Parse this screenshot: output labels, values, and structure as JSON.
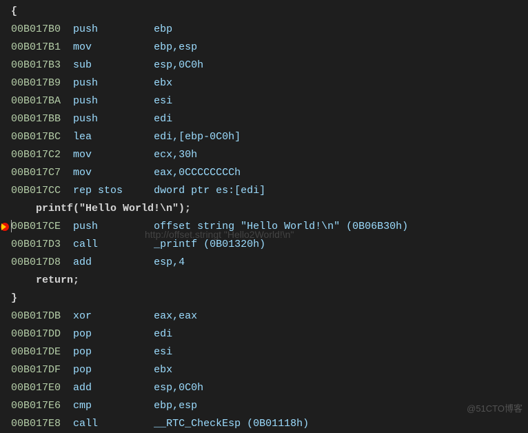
{
  "lines": [
    {
      "type": "brace",
      "text": "{"
    },
    {
      "type": "asm",
      "addr": "00B017B0",
      "mnemonic": "push",
      "operand": "ebp"
    },
    {
      "type": "asm",
      "addr": "00B017B1",
      "mnemonic": "mov",
      "operand": "ebp,esp"
    },
    {
      "type": "asm",
      "addr": "00B017B3",
      "mnemonic": "sub",
      "operand": "esp,0C0h"
    },
    {
      "type": "asm",
      "addr": "00B017B9",
      "mnemonic": "push",
      "operand": "ebx"
    },
    {
      "type": "asm",
      "addr": "00B017BA",
      "mnemonic": "push",
      "operand": "esi"
    },
    {
      "type": "asm",
      "addr": "00B017BB",
      "mnemonic": "push",
      "operand": "edi"
    },
    {
      "type": "asm",
      "addr": "00B017BC",
      "mnemonic": "lea",
      "operand": "edi,[ebp-0C0h]"
    },
    {
      "type": "asm",
      "addr": "00B017C2",
      "mnemonic": "mov",
      "operand": "ecx,30h"
    },
    {
      "type": "asm",
      "addr": "00B017C7",
      "mnemonic": "mov",
      "operand": "eax,0CCCCCCCCh"
    },
    {
      "type": "asm",
      "addr": "00B017CC",
      "mnemonic": "rep stos",
      "operand": "dword ptr es:[edi]"
    },
    {
      "type": "src",
      "text": "    printf(\"Hello World!\\n\");"
    },
    {
      "type": "asm",
      "addr": "00B017CE",
      "mnemonic": "push",
      "operand": "offset string \"Hello World!\\n\" (0B06B30h)",
      "breakpoint": true,
      "current": true
    },
    {
      "type": "asm",
      "addr": "00B017D3",
      "mnemonic": "call",
      "operand": "_printf (0B01320h)"
    },
    {
      "type": "asm",
      "addr": "00B017D8",
      "mnemonic": "add",
      "operand": "esp,4"
    },
    {
      "type": "src",
      "text": "    return;"
    },
    {
      "type": "brace",
      "text": "}"
    },
    {
      "type": "asm",
      "addr": "00B017DB",
      "mnemonic": "xor",
      "operand": "eax,eax"
    },
    {
      "type": "asm",
      "addr": "00B017DD",
      "mnemonic": "pop",
      "operand": "edi"
    },
    {
      "type": "asm",
      "addr": "00B017DE",
      "mnemonic": "pop",
      "operand": "esi"
    },
    {
      "type": "asm",
      "addr": "00B017DF",
      "mnemonic": "pop",
      "operand": "ebx"
    },
    {
      "type": "asm",
      "addr": "00B017E0",
      "mnemonic": "add",
      "operand": "esp,0C0h"
    },
    {
      "type": "asm",
      "addr": "00B017E6",
      "mnemonic": "cmp",
      "operand": "ebp,esp"
    },
    {
      "type": "asm",
      "addr": "00B017E8",
      "mnemonic": "call",
      "operand": "__RTC_CheckEsp (0B01118h)"
    }
  ],
  "watermark_center": "http://offset.stringt \"Hello2World!\\n\"",
  "watermark_corner": "@51CTO博客"
}
